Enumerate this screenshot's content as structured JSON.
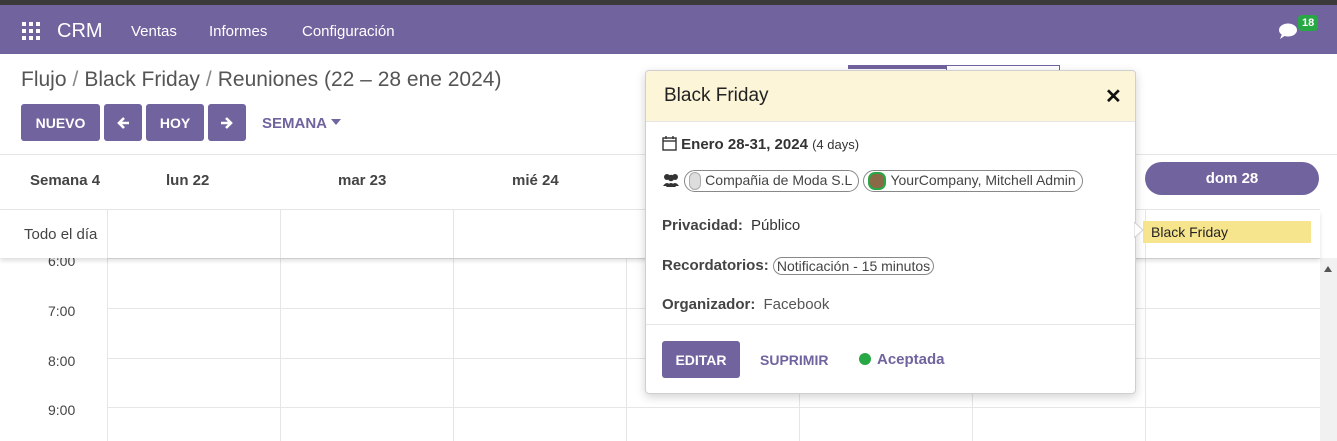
{
  "navbar": {
    "brand": "CRM",
    "menu": [
      "Ventas",
      "Informes",
      "Configuración"
    ],
    "messages_badge": "18"
  },
  "breadcrumb": {
    "items": [
      "Flujo",
      "Black Friday",
      "Reuniones (22 – 28 ene 2024)"
    ],
    "separator": "/"
  },
  "toolbar": {
    "new_label": "NUEVO",
    "prev_icon": "arrow-left-icon",
    "today_label": "HOY",
    "next_icon": "arrow-right-icon",
    "scale_label": "SEMANA"
  },
  "calendar": {
    "week_label": "Semana 4",
    "days": [
      "lun 22",
      "mar 23",
      "mié 24"
    ],
    "today_day": "dom 28",
    "allday_label": "Todo el día",
    "allday_event": "Black Friday",
    "hours": [
      "6:00",
      "7:00",
      "8:00",
      "9:00"
    ]
  },
  "popover": {
    "title": "Black Friday",
    "close_icon": "close-icon",
    "date_text": "Enero 28-31, 2024",
    "duration_text": "(4 days)",
    "attendees": [
      "Compañia de Moda S.L",
      "YourCompany, Mitchell Admin"
    ],
    "privacy_label": "Privacidad:",
    "privacy_value": "Público",
    "reminders_label": "Recordatorios:",
    "reminder_value": "Notificación - 15 minutos",
    "organizer_label": "Organizador:",
    "organizer_value": "Facebook",
    "edit_label": "EDITAR",
    "delete_label": "SUPRIMIR",
    "status_label": "Aceptada"
  },
  "colors": {
    "brand": "#71639e",
    "event_yellow": "#f7e58e",
    "accepted_green": "#28a745"
  }
}
